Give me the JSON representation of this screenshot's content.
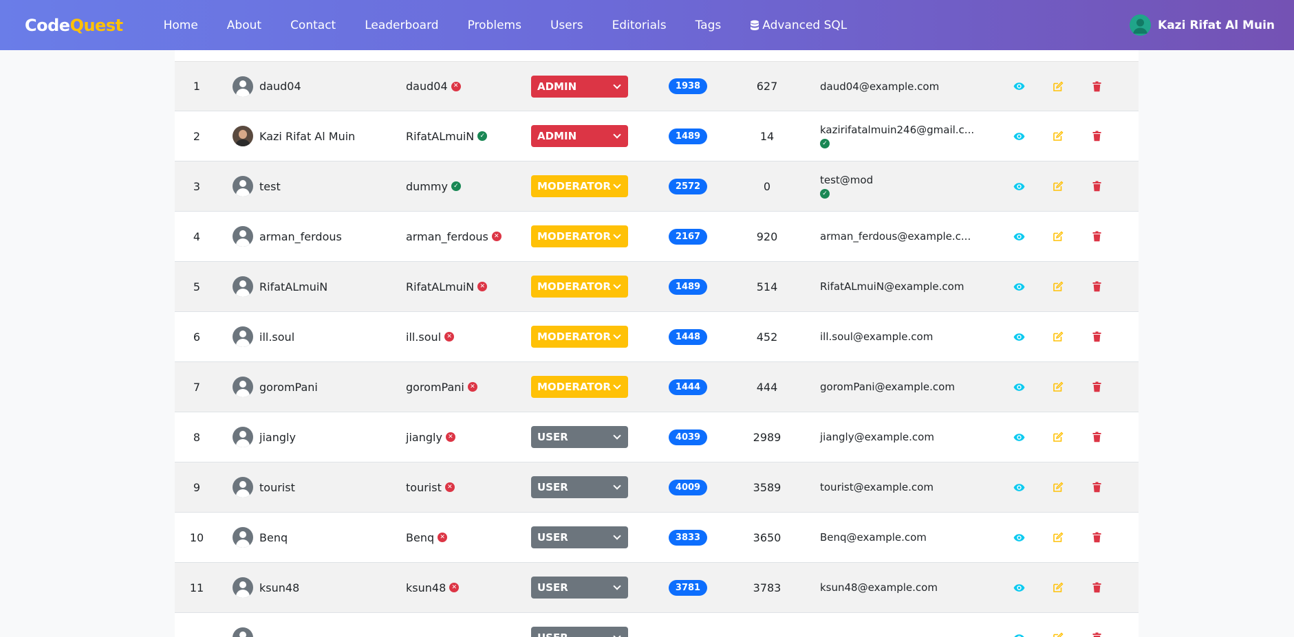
{
  "brand": {
    "part1": "Code",
    "part2": "Quest"
  },
  "nav": {
    "links": [
      "Home",
      "About",
      "Contact",
      "Leaderboard",
      "Problems",
      "Users",
      "Editorials",
      "Tags",
      "Advanced SQL"
    ],
    "user_name": "Kazi Rifat Al Muin"
  },
  "colors": {
    "admin": "#dc3545",
    "moderator": "#ffc107",
    "user": "#6c757d",
    "rating": "#0d6efd",
    "view": "#0dcaf0",
    "edit": "#ffc107",
    "delete": "#dc3545"
  },
  "users": [
    {
      "num": "1",
      "name": "daud04",
      "handle": "daud04",
      "verified": false,
      "role": "ADMIN",
      "rating": "1938",
      "solved": "627",
      "email": "daud04@example.com",
      "email_verified": null,
      "avatar": "default"
    },
    {
      "num": "2",
      "name": "Kazi Rifat Al Muin",
      "handle": "RifatALmuiN",
      "verified": true,
      "role": "ADMIN",
      "rating": "1489",
      "solved": "14",
      "email": "kazirifatalmuin246@gmail.c...",
      "email_verified": true,
      "avatar": "photo"
    },
    {
      "num": "3",
      "name": "test",
      "handle": "dummy",
      "verified": true,
      "role": "MODERATOR",
      "rating": "2572",
      "solved": "0",
      "email": "test@mod",
      "email_verified": true,
      "avatar": "default"
    },
    {
      "num": "4",
      "name": "arman_ferdous",
      "handle": "arman_ferdous",
      "verified": false,
      "role": "MODERATOR",
      "rating": "2167",
      "solved": "920",
      "email": "arman_ferdous@example.c...",
      "email_verified": null,
      "avatar": "default"
    },
    {
      "num": "5",
      "name": "RifatALmuiN",
      "handle": "RifatALmuiN",
      "verified": false,
      "role": "MODERATOR",
      "rating": "1489",
      "solved": "514",
      "email": "RifatALmuiN@example.com",
      "email_verified": null,
      "avatar": "default"
    },
    {
      "num": "6",
      "name": "ill.soul",
      "handle": "ill.soul",
      "verified": false,
      "role": "MODERATOR",
      "rating": "1448",
      "solved": "452",
      "email": "ill.soul@example.com",
      "email_verified": null,
      "avatar": "default"
    },
    {
      "num": "7",
      "name": "goromPani",
      "handle": "goromPani",
      "verified": false,
      "role": "MODERATOR",
      "rating": "1444",
      "solved": "444",
      "email": "goromPani@example.com",
      "email_verified": null,
      "avatar": "default"
    },
    {
      "num": "8",
      "name": "jiangly",
      "handle": "jiangly",
      "verified": false,
      "role": "USER",
      "rating": "4039",
      "solved": "2989",
      "email": "jiangly@example.com",
      "email_verified": null,
      "avatar": "default"
    },
    {
      "num": "9",
      "name": "tourist",
      "handle": "tourist",
      "verified": false,
      "role": "USER",
      "rating": "4009",
      "solved": "3589",
      "email": "tourist@example.com",
      "email_verified": null,
      "avatar": "default"
    },
    {
      "num": "10",
      "name": "Benq",
      "handle": "Benq",
      "verified": false,
      "role": "USER",
      "rating": "3833",
      "solved": "3650",
      "email": "Benq@example.com",
      "email_verified": null,
      "avatar": "default"
    },
    {
      "num": "11",
      "name": "ksun48",
      "handle": "ksun48",
      "verified": false,
      "role": "USER",
      "rating": "3781",
      "solved": "3783",
      "email": "ksun48@example.com",
      "email_verified": null,
      "avatar": "default"
    },
    {
      "num": "",
      "name": "",
      "handle": "",
      "verified": false,
      "role": "USER",
      "rating": "",
      "solved": "",
      "email": "",
      "email_verified": null,
      "avatar": "default"
    }
  ]
}
